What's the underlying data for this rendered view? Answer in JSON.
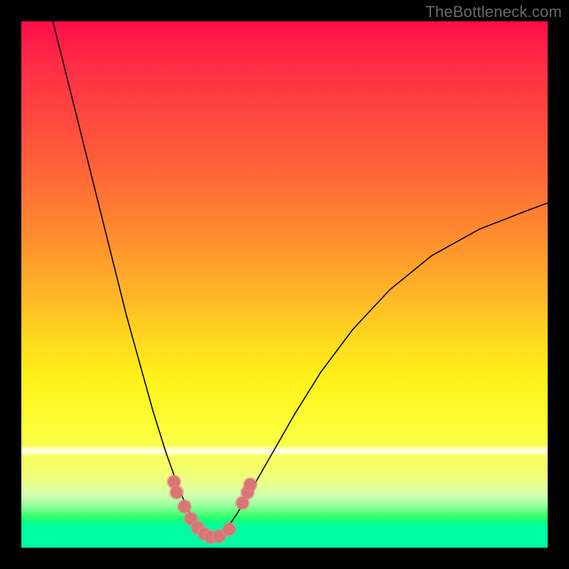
{
  "watermark": "TheBottleneck.com",
  "colors": {
    "frame": "#000000",
    "curve": "#000000",
    "marker_fill": "#d97575",
    "marker_ring": "#e08a8a",
    "gradient_stops": [
      "#ff0d4a",
      "#ff2c46",
      "#ff5a3a",
      "#ff8a2f",
      "#ffb626",
      "#ffd71f",
      "#fff21a",
      "#fdff3b",
      "#f4ff6a",
      "#e7ff8f",
      "#d3ffb1",
      "#97ff9c",
      "#37ff6d",
      "#0dff80",
      "#00ffa2"
    ]
  },
  "chart_data": {
    "type": "line",
    "title": "",
    "xlabel": "",
    "ylabel": "",
    "xlim": [
      0,
      1
    ],
    "ylim": [
      0,
      1
    ],
    "grid": false,
    "legend": false,
    "x_min_of_curve": 0.36,
    "series": [
      {
        "name": "bottleneck-curve",
        "x": [
          0.06,
          0.08,
          0.1,
          0.125,
          0.15,
          0.175,
          0.2,
          0.225,
          0.25,
          0.275,
          0.3,
          0.32,
          0.34,
          0.355,
          0.36,
          0.37,
          0.39,
          0.41,
          0.44,
          0.48,
          0.52,
          0.57,
          0.63,
          0.7,
          0.78,
          0.87,
          0.96,
          1.0
        ],
        "y": [
          1.0,
          0.92,
          0.84,
          0.74,
          0.64,
          0.54,
          0.44,
          0.35,
          0.26,
          0.18,
          0.11,
          0.065,
          0.035,
          0.02,
          0.018,
          0.02,
          0.035,
          0.065,
          0.115,
          0.185,
          0.255,
          0.335,
          0.415,
          0.49,
          0.555,
          0.605,
          0.64,
          0.655
        ]
      }
    ],
    "markers": [
      {
        "x": 0.29,
        "y": 0.125
      },
      {
        "x": 0.295,
        "y": 0.105
      },
      {
        "x": 0.31,
        "y": 0.078
      },
      {
        "x": 0.322,
        "y": 0.055
      },
      {
        "x": 0.335,
        "y": 0.038
      },
      {
        "x": 0.348,
        "y": 0.026
      },
      {
        "x": 0.36,
        "y": 0.02
      },
      {
        "x": 0.376,
        "y": 0.022
      },
      {
        "x": 0.395,
        "y": 0.035
      },
      {
        "x": 0.42,
        "y": 0.085
      },
      {
        "x": 0.43,
        "y": 0.105
      },
      {
        "x": 0.435,
        "y": 0.12
      }
    ],
    "marker_radius_px": 10
  }
}
